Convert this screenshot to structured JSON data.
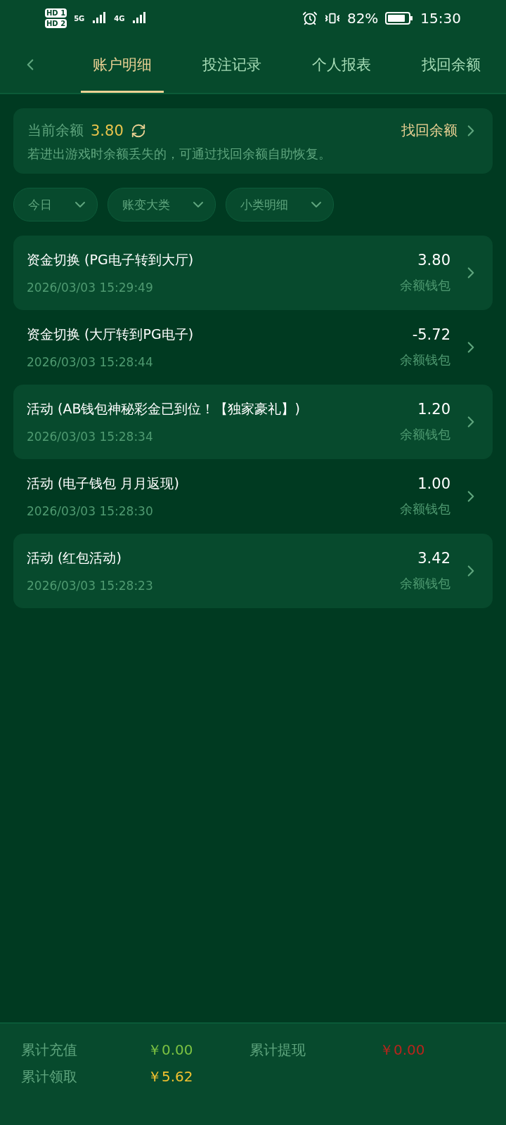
{
  "status_bar": {
    "sims": [
      {
        "label": "HD",
        "slot": "1"
      },
      {
        "label": "HD",
        "slot": "2"
      }
    ],
    "networks": [
      "5G",
      "4G"
    ],
    "battery": "82%",
    "time": "15:30"
  },
  "tabs": [
    {
      "label": "账户明细",
      "selected": true
    },
    {
      "label": "投注记录",
      "selected": false
    },
    {
      "label": "个人报表",
      "selected": false
    },
    {
      "label": "找回余额",
      "selected": false
    }
  ],
  "balance": {
    "label": "当前余额",
    "amount": "3.80",
    "link": "找回余额",
    "note": "若进出游戏时余额丢失的，可通过找回余额自助恢复。"
  },
  "filters": [
    "今日",
    "账变大类",
    "小类明细"
  ],
  "records": [
    {
      "title": "资金切换 (PG电子转到大厅)",
      "time": "2026/03/03 15:29:49",
      "amount": "3.80",
      "wallet": "余额钱包"
    },
    {
      "title": "资金切换 (大厅转到PG电子)",
      "time": "2026/03/03 15:28:44",
      "amount": "-5.72",
      "wallet": "余额钱包"
    },
    {
      "title": "活动 (AB钱包神秘彩金已到位！【独家豪礼】)",
      "time": "2026/03/03 15:28:34",
      "amount": "1.20",
      "wallet": "余额钱包"
    },
    {
      "title": "活动 (电子钱包 月月返现)",
      "time": "2026/03/03 15:28:30",
      "amount": "1.00",
      "wallet": "余额钱包"
    },
    {
      "title": "活动 (红包活动)",
      "time": "2026/03/03 15:28:23",
      "amount": "3.42",
      "wallet": "余额钱包"
    }
  ],
  "totals": [
    {
      "label": "累计充值",
      "value": "￥0.00",
      "color": "#7cc242"
    },
    {
      "label": "累计提现",
      "value": "￥0.00",
      "color": "#b8241c"
    },
    {
      "label": "累计领取",
      "value": "￥5.62",
      "color": "#f2c230"
    }
  ]
}
